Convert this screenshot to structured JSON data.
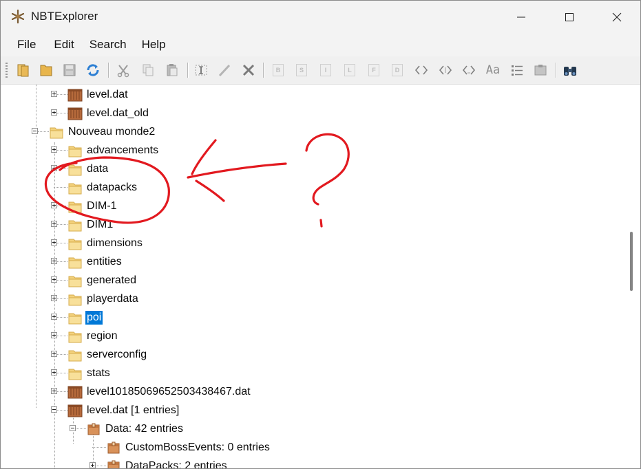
{
  "window": {
    "title": "NBTExplorer"
  },
  "menu": [
    {
      "label": "File"
    },
    {
      "label": "Edit"
    },
    {
      "label": "Search"
    },
    {
      "label": "Help"
    }
  ],
  "toolbar": {
    "letters": [
      "B",
      "S",
      "I",
      "L",
      "F",
      "D"
    ],
    "case_label": "Aa"
  },
  "tree": {
    "items": [
      {
        "label": "level.dat",
        "icon": "nbt-file-icon"
      },
      {
        "label": "level.dat_old",
        "icon": "nbt-file-icon"
      },
      {
        "label": "Nouveau monde2",
        "icon": "folder-icon"
      },
      {
        "label": "advancements",
        "icon": "folder-icon"
      },
      {
        "label": "data",
        "icon": "folder-icon"
      },
      {
        "label": "datapacks",
        "icon": "folder-icon"
      },
      {
        "label": "DIM-1",
        "icon": "folder-icon"
      },
      {
        "label": "DIM1",
        "icon": "folder-icon"
      },
      {
        "label": "dimensions",
        "icon": "folder-icon"
      },
      {
        "label": "entities",
        "icon": "folder-icon"
      },
      {
        "label": "generated",
        "icon": "folder-icon"
      },
      {
        "label": "playerdata",
        "icon": "folder-icon"
      },
      {
        "label": "poi",
        "icon": "folder-icon",
        "selected": true
      },
      {
        "label": "region",
        "icon": "folder-icon"
      },
      {
        "label": "serverconfig",
        "icon": "folder-icon"
      },
      {
        "label": "stats",
        "icon": "folder-icon"
      },
      {
        "label": "level10185069652503438467.dat",
        "icon": "nbt-file-icon"
      },
      {
        "label": "level.dat [1 entries]",
        "icon": "nbt-file-icon"
      },
      {
        "label": "Data: 42 entries",
        "icon": "compound-tag-icon"
      },
      {
        "label": "CustomBossEvents: 0 entries",
        "icon": "compound-tag-icon"
      },
      {
        "label": "DataPacks: 2 entries",
        "icon": "compound-tag-icon"
      }
    ]
  },
  "annotation": {
    "color": "#e2191f"
  },
  "colors": {
    "selection": "#0078d7",
    "annotation": "#e2191f"
  }
}
